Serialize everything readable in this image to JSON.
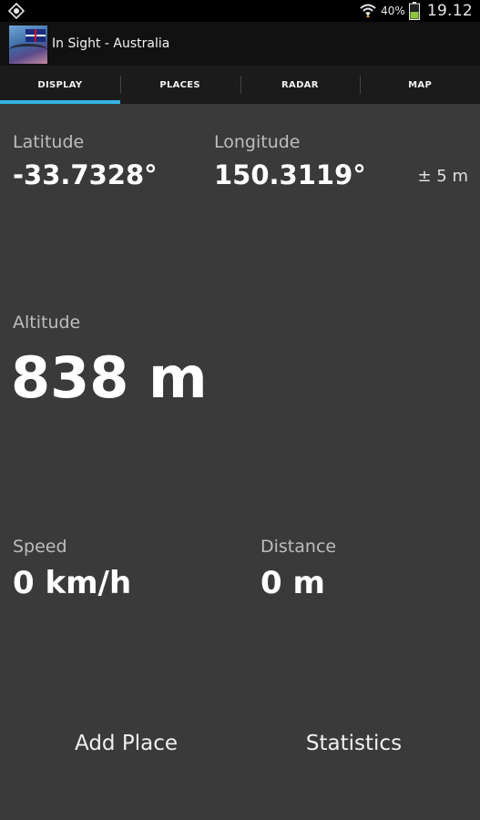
{
  "status_bar": {
    "battery_percent": "40%",
    "time": "19.12",
    "icons": [
      "gps-icon",
      "wifi-icon",
      "battery-icon"
    ]
  },
  "action_bar": {
    "title": "In Sight - Australia",
    "icon": "australia-app-icon"
  },
  "tabs": [
    {
      "label": "DISPLAY",
      "active": true
    },
    {
      "label": "PLACES",
      "active": false
    },
    {
      "label": "RADAR",
      "active": false
    },
    {
      "label": "MAP",
      "active": false
    }
  ],
  "readings": {
    "latitude": {
      "label": "Latitude",
      "value": "-33.7328°"
    },
    "longitude": {
      "label": "Longitude",
      "value": "150.3119°"
    },
    "accuracy": "± 5 m",
    "altitude": {
      "label": "Altitude",
      "value": "838 m"
    },
    "speed": {
      "label": "Speed",
      "value": "0 km/h"
    },
    "distance": {
      "label": "Distance",
      "value": "0 m"
    }
  },
  "buttons": {
    "add_place": "Add Place",
    "statistics": "Statistics"
  },
  "colors": {
    "background": "#3a3a3a",
    "tab_indicator": "#33b5e5",
    "battery_fill": "#8cc63f"
  }
}
